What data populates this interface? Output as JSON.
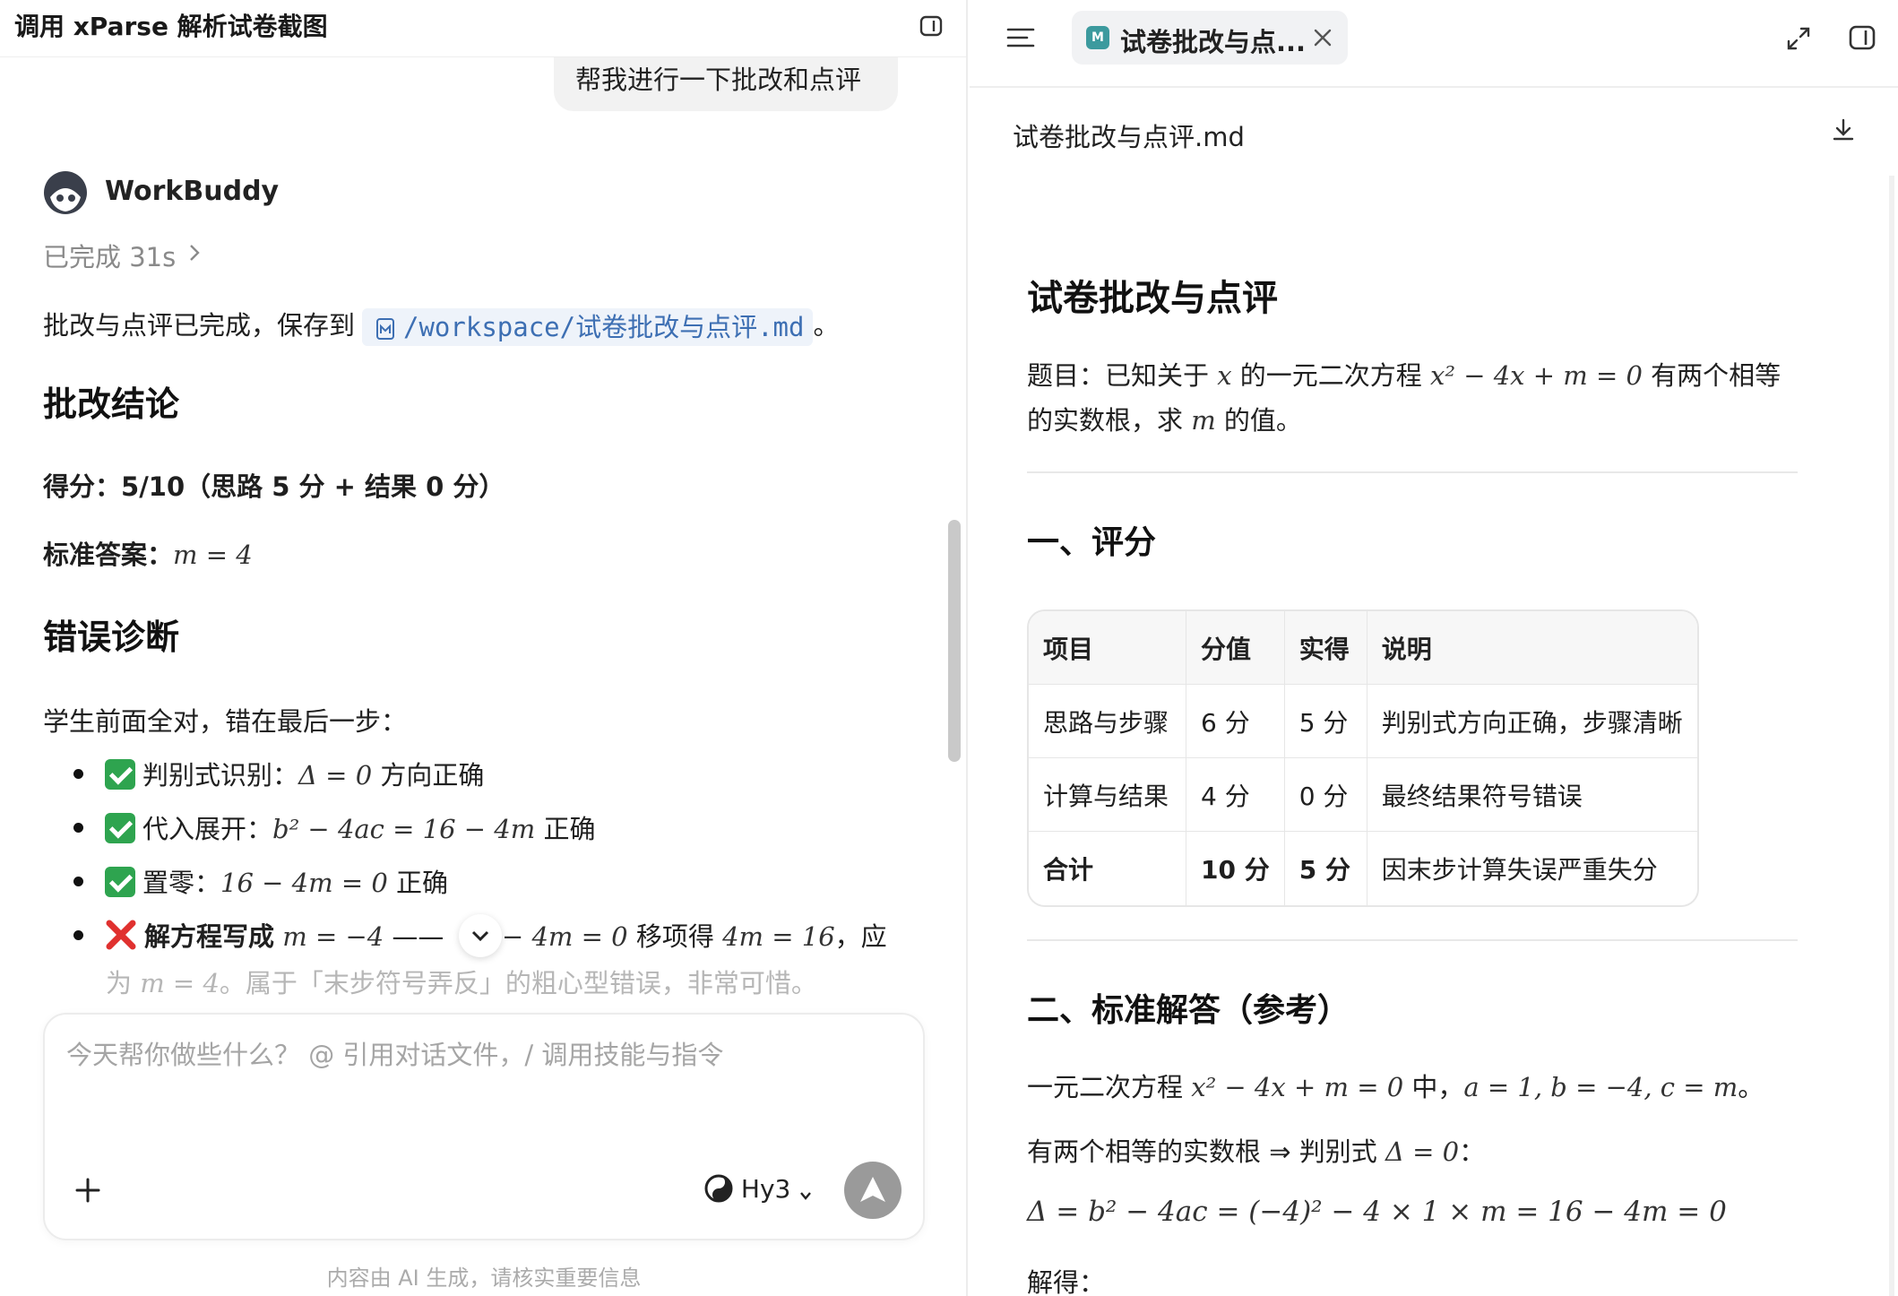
{
  "left": {
    "title": "调用 xParse 解析试卷截图",
    "user_message": "帮我进行一下批改和点评",
    "bot_name": "WorkBuddy",
    "status": "已完成 31s",
    "reply_prefix": "批改与点评已完成，保存到",
    "file_path": "/workspace/试卷批改与点评.md",
    "reply_suffix": "。",
    "section1_title": "批改结论",
    "score_label": "得分：",
    "score_value": "5/10（思路 5 分 + 结果 0 分）",
    "answer_label": "标准答案：",
    "answer_value": "m = 4",
    "section2_title": "错误诊断",
    "diag_intro": "学生前面全对，错在最后一步：",
    "bullets": [
      {
        "lead": "判别式识别：",
        "math": "Δ = 0",
        "tail": " 方向正确"
      },
      {
        "lead": "代入展开：",
        "math": "b² − 4ac = 16 − 4m",
        "tail": " 正确"
      },
      {
        "lead": "置零：",
        "math": "16 − 4m = 0",
        "tail": " 正确"
      },
      {
        "lead": "解方程写成",
        "math": "m = −4",
        "mid": " —— ",
        "math2": "− 4m = 0",
        "tail": " 移项得 ",
        "math3": "4m = 16",
        "tail2": "，应"
      }
    ],
    "fade_line_prefix": "为 ",
    "fade_line_math": "m = 4",
    "fade_line_rest": "。属于「末步符号弄反」的粗心型错误，非常可惜。",
    "composer_placeholder": "今天帮你做些什么？ @ 引用对话文件，/ 调用技能与指令",
    "model": "Hy3",
    "disclaimer": "内容由 AI 生成，请核实重要信息"
  },
  "right": {
    "tab_label": "试卷批改与点...",
    "tab_badge": "M",
    "file_name": "试卷批改与点评.md",
    "doc_title": "试卷批改与点评",
    "problem_line1_a": "题目：已知关于 ",
    "problem_line1_x": "x",
    "problem_line1_b": " 的一元二次方程 ",
    "problem_line1_eq": "x² − 4x + m = 0",
    "problem_line1_c": " 有两个相等",
    "problem_line2_a": "的实数根，求 ",
    "problem_line2_m": "m",
    "problem_line2_b": " 的值。",
    "section1": "一、评分",
    "table": {
      "headers": [
        "项目",
        "分值",
        "实得",
        "说明"
      ],
      "rows": [
        [
          "思路与步骤",
          "6 分",
          "5 分",
          "判别式方向正确，步骤清晰"
        ],
        [
          "计算与结果",
          "4 分",
          "0 分",
          "最终结果符号错误"
        ],
        [
          "合计",
          "10 分",
          "5 分",
          "因末步计算失误严重失分"
        ]
      ]
    },
    "section2": "二、标准解答（参考）",
    "sol_line1_a": "一元二次方程 ",
    "sol_line1_eq": "x² − 4x + m = 0",
    "sol_line1_b": " 中，",
    "sol_line1_coef": "a = 1, b = −4, c = m",
    "sol_line1_c": "。",
    "sol_line2_a": "有两个相等的实数根 ⇒ 判别式 ",
    "sol_line2_eq": "Δ = 0",
    "sol_line2_b": "：",
    "sol_line3_eq": "Δ = b² − 4ac = (−4)² − 4 × 1 × m = 16 − 4m = 0",
    "sol_line4": "解得："
  },
  "colors": {
    "accent_link": "#3d6fb3",
    "check_green": "#2ea44f",
    "cross_red": "#e0312f",
    "md_badge": "#3c9a9e"
  }
}
